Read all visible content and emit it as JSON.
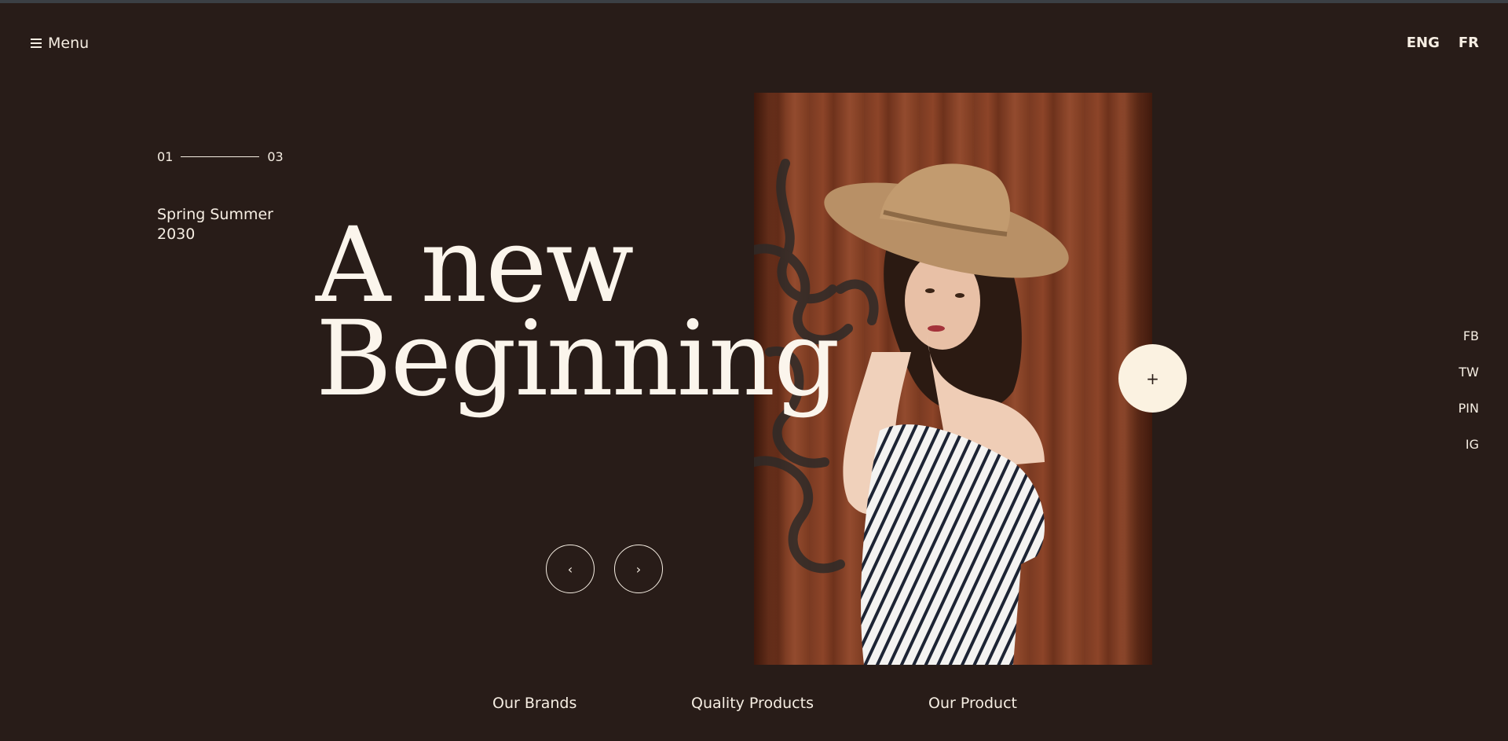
{
  "header": {
    "menu_label": "Menu",
    "languages": [
      "ENG",
      "FR"
    ]
  },
  "slider": {
    "current": "01",
    "total": "03",
    "season": "Spring Summer 2030",
    "headline_line1": "A new",
    "headline_line2": "Beginning",
    "prev_icon": "‹",
    "next_icon": "›",
    "plus_icon": "+"
  },
  "social": [
    "FB",
    "TW",
    "PIN",
    "IG"
  ],
  "bottom_nav": [
    "Our Brands",
    "Quality Products",
    "Our Product"
  ],
  "colors": {
    "background": "#281c18",
    "text": "#f6eee3",
    "accent": "#fbf2e1"
  }
}
